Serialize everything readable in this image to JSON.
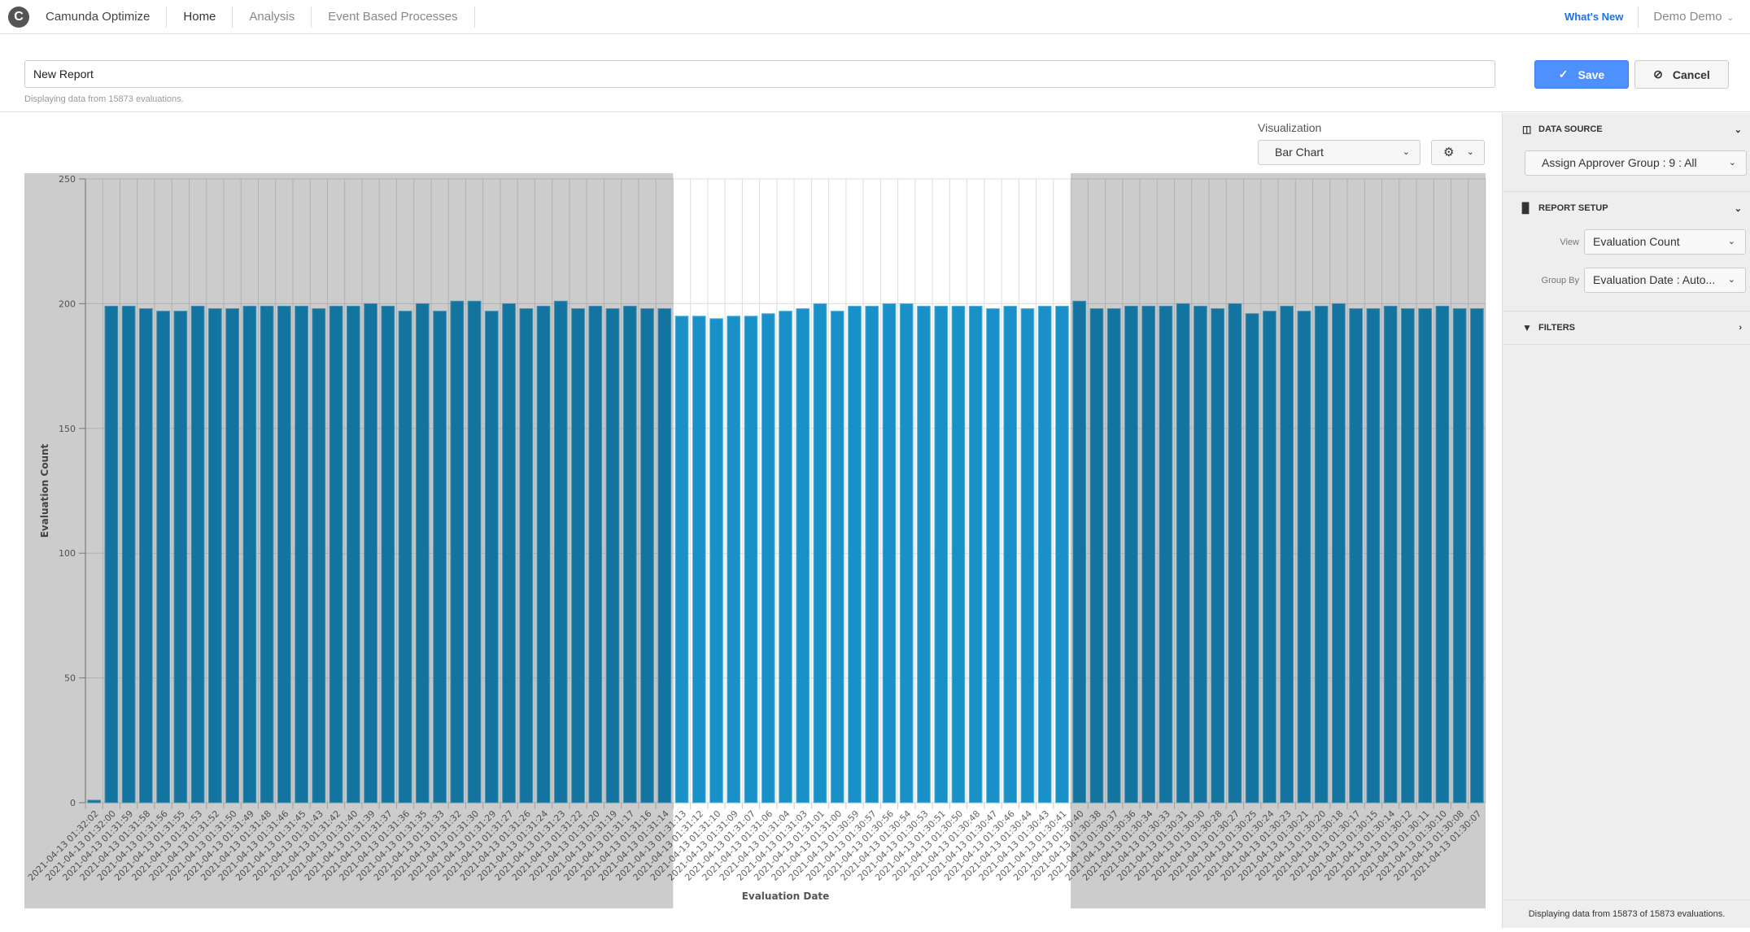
{
  "app": {
    "logo_letter": "C",
    "brand": "Camunda Optimize",
    "nav": [
      {
        "label": "Home",
        "active": true
      },
      {
        "label": "Analysis",
        "active": false
      },
      {
        "label": "Event Based Processes",
        "active": false
      }
    ],
    "whats_new": "What's New",
    "user": "Demo Demo",
    "accent_color": "#4d90fe"
  },
  "report": {
    "name": "New Report",
    "info": "Displaying data from 15873 evaluations.",
    "save_label": "Save",
    "cancel_label": "Cancel"
  },
  "visualization": {
    "label": "Visualization",
    "selected": "Bar Chart",
    "settings_icon": "gear-icon"
  },
  "sidebar": {
    "data_source": {
      "title": "DATA SOURCE",
      "selected": "Assign Approver Group : 9 : All"
    },
    "report_setup": {
      "title": "REPORT SETUP",
      "view_label": "View",
      "view_value": "Evaluation Count",
      "group_by_label": "Group By",
      "group_by_value": "Evaluation Date : Auto..."
    },
    "filters": {
      "title": "FILTERS"
    },
    "status": "Displaying data from 15873 of 15873 evaluations."
  },
  "chart_data": {
    "type": "bar",
    "title": "",
    "xlabel": "Evaluation Date",
    "ylabel": "Evaluation Count",
    "ylim": [
      0,
      250
    ],
    "yticks": [
      0,
      50,
      100,
      150,
      200,
      250
    ],
    "grid": true,
    "bar_color": "#1991c8",
    "selection_range_categories": [
      "2021-04-13 01:31:13",
      "2021-04-13 01:30:41"
    ],
    "categories": [
      "2021-04-13 01:32:02",
      "2021-04-13 01:32:00",
      "2021-04-13 01:31:59",
      "2021-04-13 01:31:58",
      "2021-04-13 01:31:56",
      "2021-04-13 01:31:55",
      "2021-04-13 01:31:53",
      "2021-04-13 01:31:52",
      "2021-04-13 01:31:50",
      "2021-04-13 01:31:49",
      "2021-04-13 01:31:48",
      "2021-04-13 01:31:46",
      "2021-04-13 01:31:45",
      "2021-04-13 01:31:43",
      "2021-04-13 01:31:42",
      "2021-04-13 01:31:40",
      "2021-04-13 01:31:39",
      "2021-04-13 01:31:37",
      "2021-04-13 01:31:36",
      "2021-04-13 01:31:35",
      "2021-04-13 01:31:33",
      "2021-04-13 01:31:32",
      "2021-04-13 01:31:30",
      "2021-04-13 01:31:29",
      "2021-04-13 01:31:27",
      "2021-04-13 01:31:26",
      "2021-04-13 01:31:24",
      "2021-04-13 01:31:23",
      "2021-04-13 01:31:22",
      "2021-04-13 01:31:20",
      "2021-04-13 01:31:19",
      "2021-04-13 01:31:17",
      "2021-04-13 01:31:16",
      "2021-04-13 01:31:14",
      "2021-04-13 01:31:13",
      "2021-04-13 01:31:12",
      "2021-04-13 01:31:10",
      "2021-04-13 01:31:09",
      "2021-04-13 01:31:07",
      "2021-04-13 01:31:06",
      "2021-04-13 01:31:04",
      "2021-04-13 01:31:03",
      "2021-04-13 01:31:01",
      "2021-04-13 01:31:00",
      "2021-04-13 01:30:59",
      "2021-04-13 01:30:57",
      "2021-04-13 01:30:56",
      "2021-04-13 01:30:54",
      "2021-04-13 01:30:53",
      "2021-04-13 01:30:51",
      "2021-04-13 01:30:50",
      "2021-04-13 01:30:48",
      "2021-04-13 01:30:47",
      "2021-04-13 01:30:46",
      "2021-04-13 01:30:44",
      "2021-04-13 01:30:43",
      "2021-04-13 01:30:41",
      "2021-04-13 01:30:40",
      "2021-04-13 01:30:38",
      "2021-04-13 01:30:37",
      "2021-04-13 01:30:36",
      "2021-04-13 01:30:34",
      "2021-04-13 01:30:33",
      "2021-04-13 01:30:31",
      "2021-04-13 01:30:30",
      "2021-04-13 01:30:28",
      "2021-04-13 01:30:27",
      "2021-04-13 01:30:25",
      "2021-04-13 01:30:24",
      "2021-04-13 01:30:23",
      "2021-04-13 01:30:21",
      "2021-04-13 01:30:20",
      "2021-04-13 01:30:18",
      "2021-04-13 01:30:17",
      "2021-04-13 01:30:15",
      "2021-04-13 01:30:14",
      "2021-04-13 01:30:12",
      "2021-04-13 01:30:11",
      "2021-04-13 01:30:10",
      "2021-04-13 01:30:08",
      "2021-04-13 01:30:07"
    ],
    "values": [
      1,
      199,
      199,
      198,
      197,
      197,
      199,
      198,
      198,
      199,
      199,
      199,
      199,
      198,
      199,
      199,
      200,
      199,
      197,
      200,
      197,
      201,
      201,
      197,
      200,
      198,
      199,
      201,
      198,
      199,
      198,
      199,
      198,
      198,
      195,
      195,
      194,
      195,
      195,
      196,
      197,
      198,
      200,
      197,
      199,
      199,
      200,
      200,
      199,
      199,
      199,
      199,
      198,
      199,
      198,
      199,
      199,
      201,
      198,
      198,
      199,
      199,
      199,
      200,
      199,
      198,
      200,
      196,
      197,
      199,
      197,
      199,
      200,
      198,
      198,
      199,
      198,
      198,
      199,
      198,
      198
    ]
  }
}
